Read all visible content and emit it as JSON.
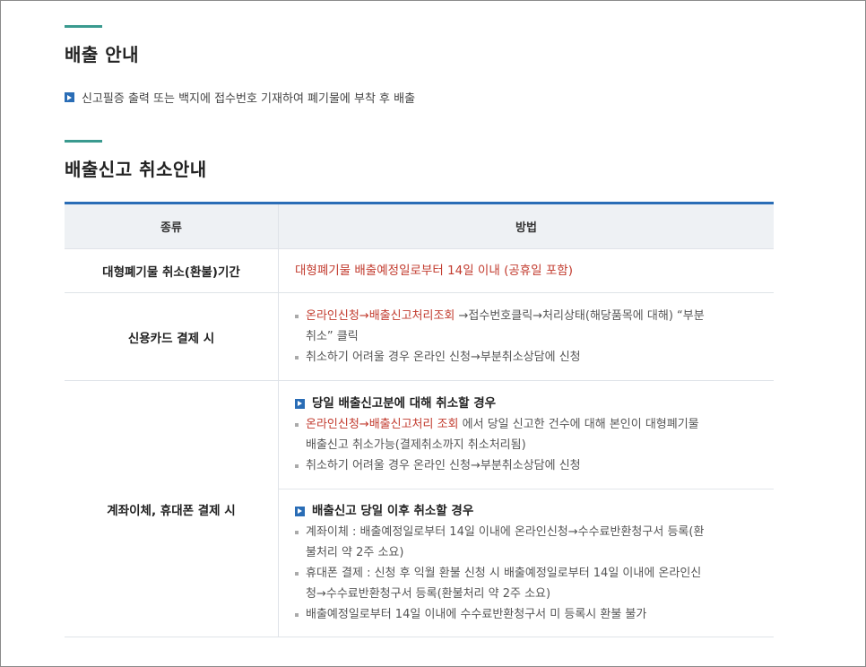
{
  "section1": {
    "title": "배출 안내",
    "guide": "신고필증 출력 또는 백지에 접수번호 기재하여 폐기물에 부착 후 배출"
  },
  "section2": {
    "title": "배출신고 취소안내",
    "table": {
      "header": {
        "kind": "종류",
        "method": "방법"
      },
      "row1": {
        "kind": "대형폐기물 취소(환불)기간",
        "method": "대형폐기물 배출예정일로부터 14일 이내 (공휴일 포함)"
      },
      "row2": {
        "kind": "신용카드 결제 시",
        "line1_link": "온라인신청→배출신고처리조회",
        "line1_rest_a": " →접수번호클릭→처리상태(해당품목에 대해) “부분",
        "line1_rest_b": "취소” 클릭",
        "line2": "취소하기 어려울 경우 온라인 신청→부분취소상담에 신청"
      },
      "row3": {
        "kind": "계좌이체, 휴대폰 결제 시",
        "sub1_title": "당일 배출신고분에 대해 취소할 경우",
        "sub1_line1_link": "온라인신청→배출신고처리 조회",
        "sub1_line1_rest_a": " 에서 당일 신고한 건수에 대해 본인이 대형폐기물",
        "sub1_line1_rest_b": "배출신고 취소가능(결제취소까지 취소처리됨)",
        "sub1_line2": "취소하기 어려울 경우 온라인 신청→부분취소상담에 신청",
        "sub2_title": "배출신고 당일 이후 취소할 경우",
        "sub2_line1_a": "계좌이체 : 배출예정일로부터 14일 이내에 온라인신청→수수료반환청구서 등록(환",
        "sub2_line1_b": "불처리 약 2주 소요)",
        "sub2_line2_a": "휴대폰 결제 : 신청 후 익월 환불 신청 시 배출예정일로부터 14일 이내에 온라인신",
        "sub2_line2_b": "청→수수료반환청구서 등록(환불처리 약 2주 소요)",
        "sub2_line3": "배출예정일로부터 14일 이내에 수수료반환청구서 미 등록시 환불 불가"
      }
    }
  }
}
